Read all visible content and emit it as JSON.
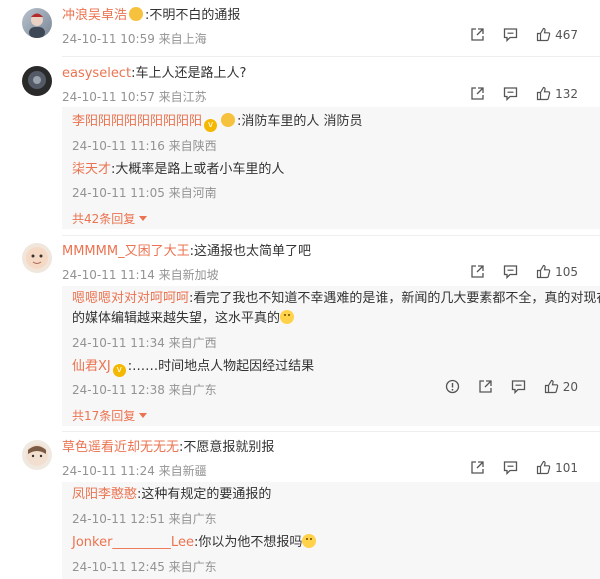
{
  "comments": [
    {
      "user": "冲浪吴卓浩",
      "text": ":不明不白的通报",
      "time": "24-10-11 10:59 来自上海",
      "likes": "467"
    },
    {
      "user": "easyselect",
      "text": ":车上人还是路上人?",
      "time": "24-10-11 10:57 来自江苏",
      "likes": "132",
      "replies": [
        {
          "user": "李阳阳阳阳阳阳阳阳阳",
          "text": ":消防车里的人 消防员",
          "time": "24-10-11 11:16 来自陕西"
        },
        {
          "user": "柒天才",
          "text": ":大概率是路上或者小车里的人",
          "time": "24-10-11 11:05 来自河南"
        }
      ],
      "more": "共42条回复"
    },
    {
      "user": "MMMMM_又困了大王",
      "text": ":这通报也太简单了吧",
      "time": "24-10-11 11:14 来自新加坡",
      "likes": "105",
      "replies": [
        {
          "user": "嗯嗯嗯对对对呵呵呵",
          "text": ":看完了我也不知道不幸遇难的是谁，新闻的几大要素都不全，真的对现在",
          "text2": "的媒体编辑越来越失望，这水平真的",
          "time": "24-10-11 11:34 来自广西"
        },
        {
          "user": "仙君XJ",
          "text": ":……时间地点人物起因经过结果",
          "time": "24-10-11 12:38 来自广东",
          "likes": "20"
        }
      ],
      "more": "共17条回复"
    },
    {
      "user": "草色遥看近却无无无",
      "text": ":不愿意报就别报",
      "time": "24-10-11 11:24 来自新疆",
      "likes": "101",
      "replies": [
        {
          "user": "凤阳李憨憨",
          "text": ":这种有规定的要通报的",
          "time": "24-10-11 12:51 来自广东"
        },
        {
          "user": "Jonker_________Lee",
          "text": ":你以为他不想报吗",
          "time": "24-10-11 12:45 来自广东"
        }
      ]
    }
  ],
  "colors": {
    "username": "#eb7350",
    "meta": "#939393",
    "reply_bg": "#f7f7f7"
  },
  "icons": [
    "share-icon",
    "comment-icon",
    "like-icon",
    "report-icon"
  ]
}
